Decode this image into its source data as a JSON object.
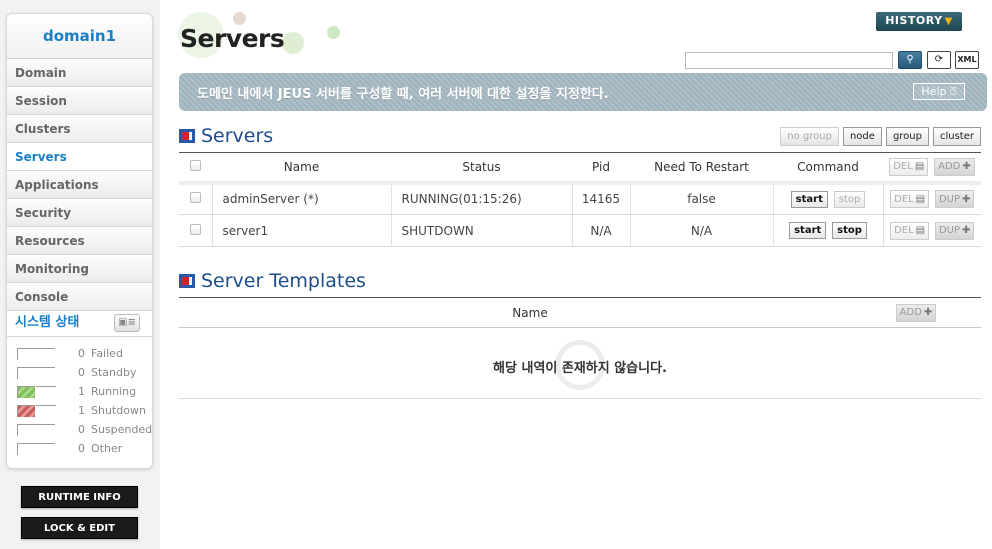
{
  "sidebar": {
    "domain": "domain1",
    "nav": [
      "Domain",
      "Session",
      "Clusters",
      "Servers",
      "Applications",
      "Security",
      "Resources",
      "Monitoring",
      "Console"
    ],
    "active_nav": "Servers",
    "system_status": {
      "title": "시스템 상태",
      "items": [
        {
          "count": "0",
          "label": "Failed"
        },
        {
          "count": "0",
          "label": "Standby"
        },
        {
          "count": "1",
          "label": "Running"
        },
        {
          "count": "1",
          "label": "Shutdown"
        },
        {
          "count": "0",
          "label": "Suspended"
        },
        {
          "count": "0",
          "label": "Other"
        }
      ]
    },
    "runtime_info": "RUNTIME INFO",
    "lock_edit": "LOCK & EDIT"
  },
  "header": {
    "title": "Servers",
    "history": "HISTORY",
    "search_value": "",
    "xml_label": "XML"
  },
  "banner": {
    "text": "도메인 내에서 JEUS 서버를 구성할 때, 여러 서버에 대한 설정을 지정한다.",
    "help": "Help"
  },
  "servers": {
    "title": "Servers",
    "filters": [
      "no group",
      "node",
      "group",
      "cluster"
    ],
    "columns": {
      "name": "Name",
      "status": "Status",
      "pid": "Pid",
      "restart": "Need To Restart",
      "command": "Command"
    },
    "del": "DEL",
    "add": "ADD",
    "dup": "DUP",
    "start": "start",
    "stop": "stop",
    "rows": [
      {
        "name": "adminServer (*)",
        "status": "RUNNING(01:15:26)",
        "pid": "14165",
        "restart": "false"
      },
      {
        "name": "server1",
        "status": "SHUTDOWN",
        "pid": "N/A",
        "restart": "N/A"
      }
    ]
  },
  "templates": {
    "title": "Server Templates",
    "column_name": "Name",
    "add": "ADD",
    "empty": "해당 내역이 존재하지 않습니다."
  },
  "colors": {
    "accent": "#1a7fc4",
    "section_title": "#1d4e8c",
    "banner": "#a7b9c2",
    "running": "#7fbf5a",
    "shutdown": "#cc5a5a"
  }
}
